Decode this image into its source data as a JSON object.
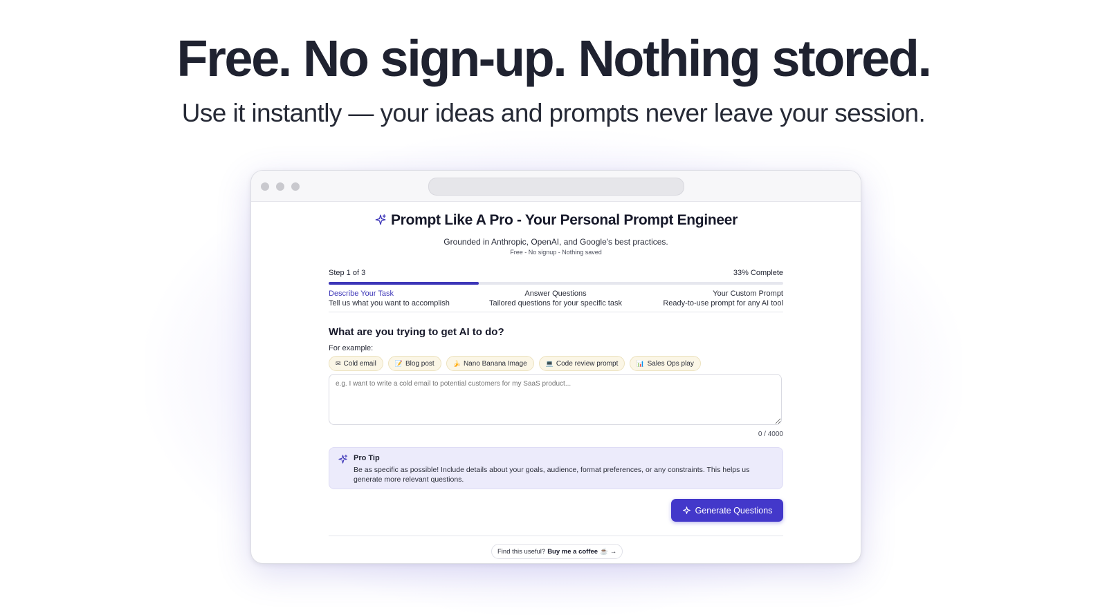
{
  "hero": {
    "title": "Free. No sign-up. Nothing stored.",
    "subtitle": "Use it instantly — your ideas and prompts never leave your session."
  },
  "app": {
    "title": "Prompt Like A Pro - Your Personal Prompt Engineer",
    "subtitle": "Grounded in Anthropic, OpenAI, and Google's best practices.",
    "tagline": "Free - No signup - Nothing saved",
    "progress": {
      "step_label": "Step 1 of 3",
      "complete_label": "33% Complete",
      "fraction": 0.33
    },
    "steps": [
      {
        "title": "Describe Your Task",
        "desc": "Tell us what you want to accomplish"
      },
      {
        "title": "Answer Questions",
        "desc": "Tailored questions for your specific task"
      },
      {
        "title": "Your Custom Prompt",
        "desc": "Ready-to-use prompt for any AI tool"
      }
    ],
    "question": "What are you trying to get AI to do?",
    "example_label": "For example:",
    "chips": [
      {
        "icon": "✉",
        "label": "Cold email"
      },
      {
        "icon": "📝",
        "label": "Blog post"
      },
      {
        "icon": "🍌",
        "label": "Nano Banana Image"
      },
      {
        "icon": "💻",
        "label": "Code review prompt"
      },
      {
        "icon": "📊",
        "label": "Sales Ops play"
      }
    ],
    "input_placeholder": "e.g. I want to write a cold email to potential customers for my SaaS product...",
    "input_value": "",
    "char_counter": "0 / 4000",
    "pro_tip": {
      "title": "Pro Tip",
      "body": "Be as specific as possible! Include details about your goals, audience, format preferences, or any constraints. This helps us generate more relevant questions."
    },
    "generate_button": "Generate Questions",
    "footer": {
      "prefix": "Find this useful?",
      "link": "Buy me a coffee",
      "icon": "☕",
      "arrow": "→"
    }
  },
  "colors": {
    "accent": "#4338ca",
    "progress": "#3d36b8",
    "tip_background": "#ecebfb",
    "chip_background": "#fbf6e6"
  }
}
